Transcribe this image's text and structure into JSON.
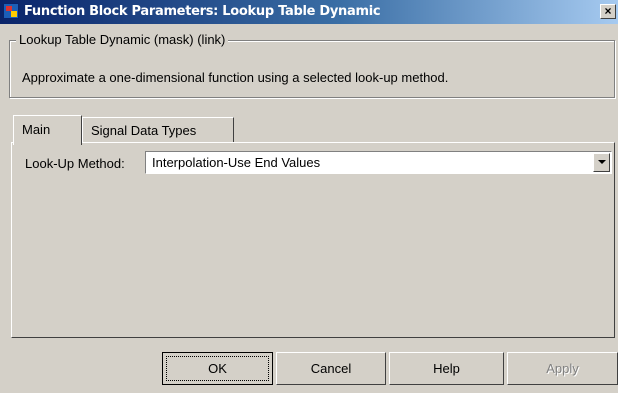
{
  "window": {
    "title": "Function Block Parameters: Lookup Table Dynamic",
    "close_symbol": "×"
  },
  "group": {
    "legend": "Lookup Table Dynamic (mask) (link)",
    "description": "Approximate a one-dimensional function using a selected look-up method."
  },
  "tabs": [
    {
      "label": "Main",
      "active": true
    },
    {
      "label": "Signal Data Types",
      "active": false
    }
  ],
  "main": {
    "lookup_label": "Look-Up Method:",
    "lookup_value": "Interpolation-Use End Values"
  },
  "buttons": {
    "ok": "OK",
    "cancel": "Cancel",
    "help": "Help",
    "apply": "Apply"
  },
  "icons": {
    "app": "simulink-block-icon",
    "close": "close-icon",
    "dropdown": "chevron-down-icon"
  }
}
